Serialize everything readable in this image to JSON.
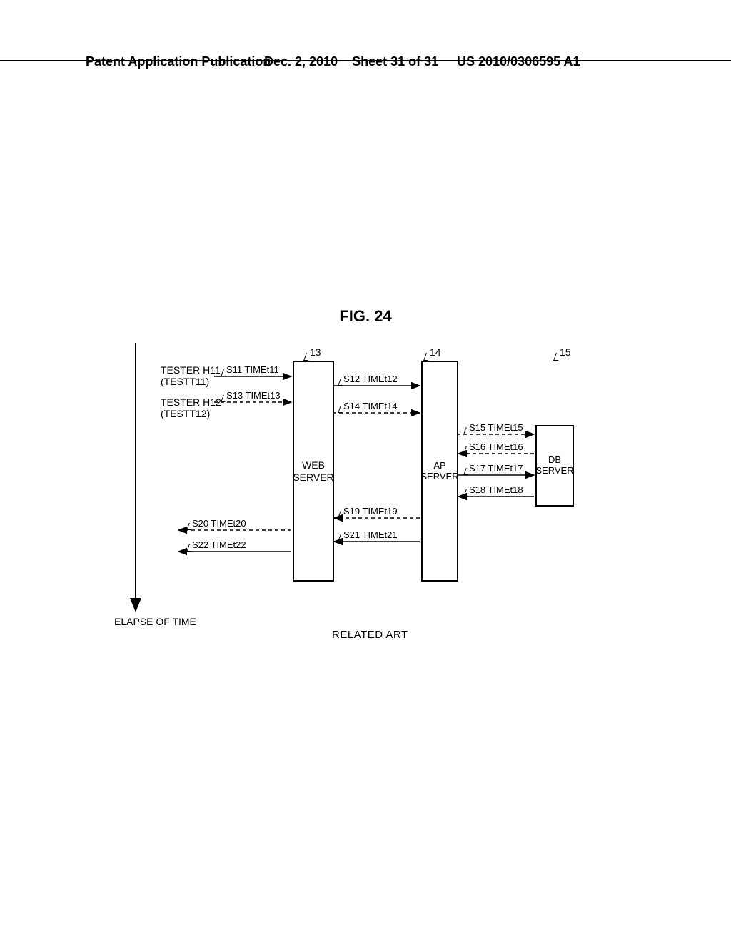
{
  "header": {
    "left": "Patent Application Publication",
    "mid_date": "Dec. 2, 2010",
    "mid_sheet": "Sheet 31 of 31",
    "right": "US 2010/0306595 A1"
  },
  "figure": {
    "title": "FIG. 24",
    "elapse": "ELAPSE OF TIME",
    "related_art": "RELATED ART"
  },
  "refs": {
    "r13": "13",
    "r14": "14",
    "r15": "15"
  },
  "servers": {
    "web": "WEB\nSERVER",
    "ap": "AP\nSERVER",
    "db": "DB\nSERVER"
  },
  "testers": {
    "h11": "TESTER H11\n(TESTT11)",
    "h12": "TESTER H12\n(TESTT12)"
  },
  "messages": {
    "s11": "S11 TIMEt11",
    "s12": "S12 TIMEt12",
    "s13": "S13 TIMEt13",
    "s14": "S14 TIMEt14",
    "s15": "S15 TIMEt15",
    "s16": "S16 TIMEt16",
    "s17": "S17 TIMEt17",
    "s18": "S18 TIMEt18",
    "s19": "S19 TIMEt19",
    "s20": "S20 TIMEt20",
    "s21": "S21 TIMEt21",
    "s22": "S22 TIMEt22"
  },
  "chart_data": {
    "type": "sequence-diagram",
    "time_axis": "vertical-down",
    "actors": [
      {
        "id": "tester-h11",
        "label": "TESTER H11 (TESTT11)"
      },
      {
        "id": "tester-h12",
        "label": "TESTER H12 (TESTT12)"
      },
      {
        "id": "web-server",
        "ref": "13",
        "label": "WEB SERVER"
      },
      {
        "id": "ap-server",
        "ref": "14",
        "label": "AP SERVER"
      },
      {
        "id": "db-server",
        "ref": "15",
        "label": "DB SERVER"
      }
    ],
    "messages": [
      {
        "id": "S11",
        "time": "t11",
        "from": "tester-h11",
        "to": "web-server",
        "style": "solid"
      },
      {
        "id": "S12",
        "time": "t12",
        "from": "web-server",
        "to": "ap-server",
        "style": "solid"
      },
      {
        "id": "S13",
        "time": "t13",
        "from": "tester-h12",
        "to": "web-server",
        "style": "dashed"
      },
      {
        "id": "S14",
        "time": "t14",
        "from": "web-server",
        "to": "ap-server",
        "style": "dashed"
      },
      {
        "id": "S15",
        "time": "t15",
        "from": "ap-server",
        "to": "db-server",
        "style": "dashed"
      },
      {
        "id": "S16",
        "time": "t16",
        "from": "db-server",
        "to": "ap-server",
        "style": "dashed"
      },
      {
        "id": "S17",
        "time": "t17",
        "from": "ap-server",
        "to": "db-server",
        "style": "solid"
      },
      {
        "id": "S18",
        "time": "t18",
        "from": "db-server",
        "to": "ap-server",
        "style": "solid"
      },
      {
        "id": "S19",
        "time": "t19",
        "from": "ap-server",
        "to": "web-server",
        "style": "dashed"
      },
      {
        "id": "S20",
        "time": "t20",
        "from": "web-server",
        "to": "tester-h12",
        "style": "dashed"
      },
      {
        "id": "S21",
        "time": "t21",
        "from": "ap-server",
        "to": "web-server",
        "style": "solid"
      },
      {
        "id": "S22",
        "time": "t22",
        "from": "web-server",
        "to": "tester-h11",
        "style": "solid"
      }
    ]
  }
}
